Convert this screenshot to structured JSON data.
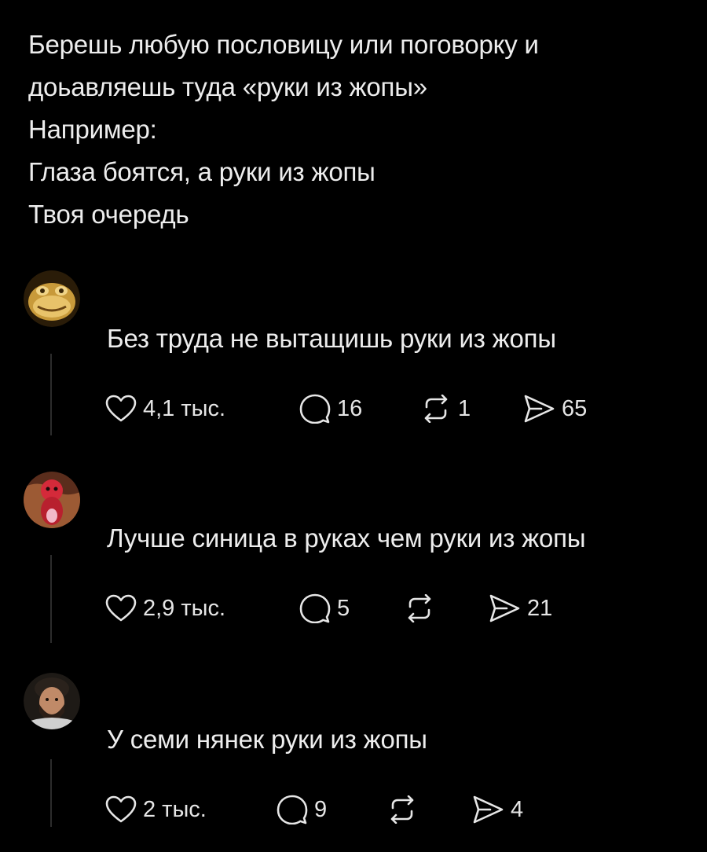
{
  "post": {
    "lines": [
      "Берешь любую пословицу или поговорку и",
      "доьавляешь туда «руки из жопы»",
      "Например:",
      "Глаза боятся, а руки из жопы",
      "Твоя очередь"
    ]
  },
  "replies": [
    {
      "avatar_icon": "frog-avatar-icon",
      "text": "Без труда не вытащишь руки из жопы",
      "likes": "4,1 тыс.",
      "comments": "16",
      "reposts": "1",
      "shares": "65"
    },
    {
      "avatar_icon": "figure-avatar-icon",
      "text": "Лучше синица в руках чем руки из жопы",
      "likes": "2,9 тыс.",
      "comments": "5",
      "reposts": "",
      "shares": "21"
    },
    {
      "avatar_icon": "man-avatar-icon",
      "text": "У семи нянек руки из жопы",
      "likes": "2 тыс.",
      "comments": "9",
      "reposts": "",
      "shares": "4"
    }
  ],
  "icons": {
    "like": "heart-icon",
    "comment": "comment-bubble-icon",
    "repost": "repost-arrows-icon",
    "share": "share-send-icon"
  },
  "colors": {
    "background": "#000000",
    "text": "#ececec",
    "thread_line": "#2c2c2c"
  }
}
